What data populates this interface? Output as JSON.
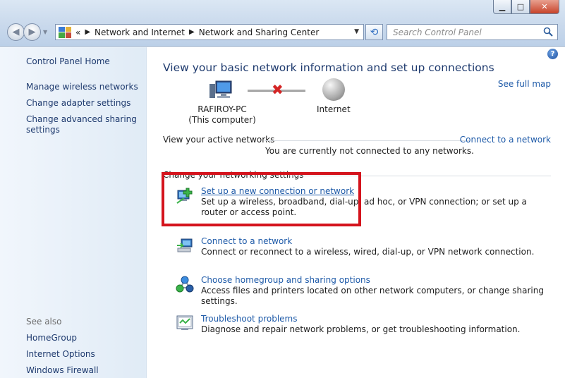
{
  "window": {
    "minimize_glyph": "▁",
    "maximize_glyph": "□",
    "close_glyph": "✕"
  },
  "navigation": {
    "back_glyph": "◀",
    "forward_glyph": "▶",
    "address_prefix": "«",
    "breadcrumbs": [
      "Network and Internet",
      "Network and Sharing Center"
    ],
    "search_placeholder": "Search Control Panel"
  },
  "sidebar": {
    "home": "Control Panel Home",
    "links": [
      "Manage wireless networks",
      "Change adapter settings",
      "Change advanced sharing settings"
    ],
    "see_also_heading": "See also",
    "see_also": [
      "HomeGroup",
      "Internet Options",
      "Windows Firewall"
    ]
  },
  "main": {
    "help_glyph": "?",
    "title": "View your basic network information and set up connections",
    "see_full_map": "See full map",
    "computer_name": "RAFIROY-PC",
    "computer_sub": "(This computer)",
    "internet_label": "Internet",
    "disconnected_glyph": "✖",
    "active_networks_label": "View your active networks",
    "connect_link": "Connect to a network",
    "not_connected_text": "You are currently not connected to any networks.",
    "change_settings_heading": "Change your networking settings",
    "tasks": [
      {
        "icon": "new-connection-icon",
        "link": "Set up a new connection or network",
        "desc": "Set up a wireless, broadband, dial-up, ad hoc, or VPN connection; or set up a router or access point."
      },
      {
        "icon": "connect-network-icon",
        "link": "Connect to a network",
        "desc": "Connect or reconnect to a wireless, wired, dial-up, or VPN network connection."
      },
      {
        "icon": "homegroup-icon",
        "link": "Choose homegroup and sharing options",
        "desc": "Access files and printers located on other network computers, or change sharing settings."
      },
      {
        "icon": "troubleshoot-icon",
        "link": "Troubleshoot problems",
        "desc": "Diagnose and repair network problems, or get troubleshooting information."
      }
    ]
  },
  "colors": {
    "link": "#1e5aa8",
    "title": "#1e3a6e",
    "highlight_box": "#d4141d"
  }
}
